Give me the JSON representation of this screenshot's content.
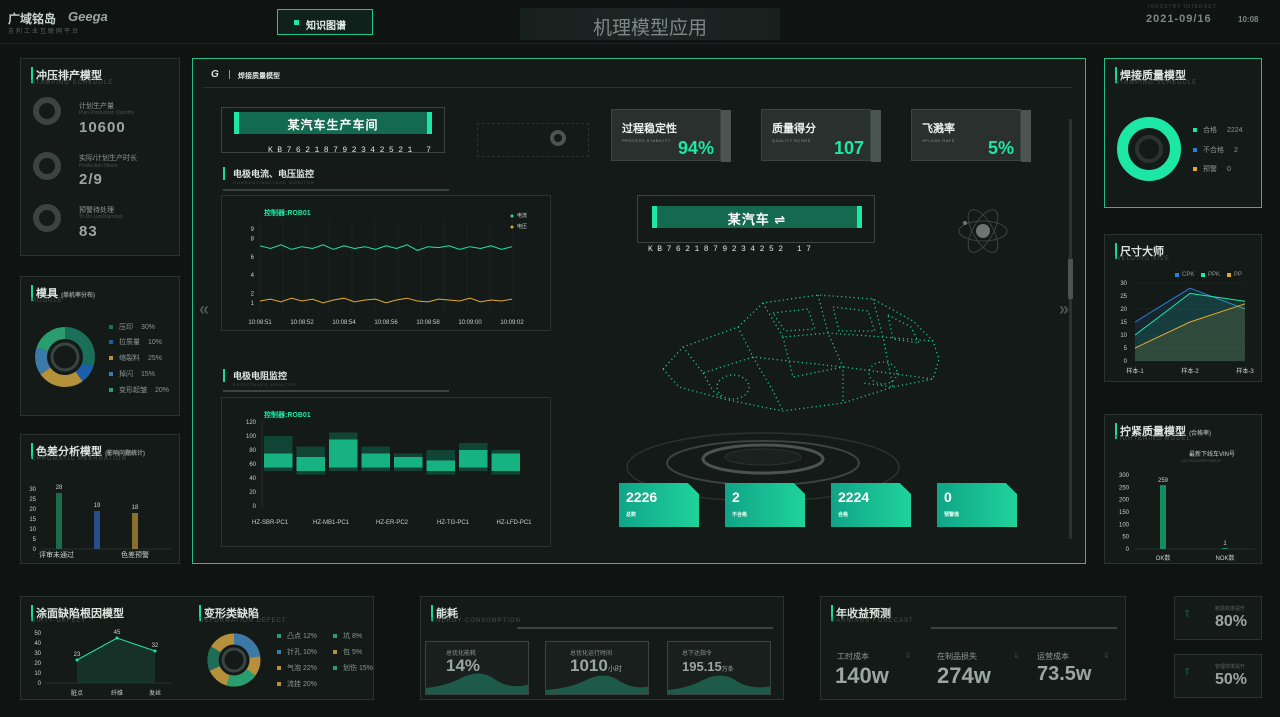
{
  "header": {
    "logo_cn": "广域铭岛",
    "logo_en": "Geega",
    "logo_sub": "吉利工业互联网平台",
    "nav_button": "知识图谱",
    "title": "机理模型应用",
    "corner_label": "INDUSTRY INTERNET",
    "date": "2021-09/16",
    "time": "10:08"
  },
  "stamping": {
    "title": "冲压排产模型",
    "sub": "STAMPING SCHEDULE",
    "items": [
      {
        "label": "计划生产量",
        "sub": "Plan Production Quantity",
        "value": "10600"
      },
      {
        "label": "实际/计划生产时长",
        "sub": "Production Hours",
        "value": "2/9"
      },
      {
        "label": "预警待处理",
        "sub": "To Do List(Warning)",
        "value": "83"
      }
    ]
  },
  "mold": {
    "title": "模具",
    "title_note": "(单机率分布)",
    "sub": "MODULE",
    "items": [
      {
        "label": "压印",
        "value": "30%",
        "color": "#1b6e58"
      },
      {
        "label": "拉质量",
        "value": "10%",
        "color": "#1d5ea8"
      },
      {
        "label": "缩裂料",
        "value": "25%",
        "color": "#b4913a"
      },
      {
        "label": "掉闪",
        "value": "15%",
        "color": "#3c78a8"
      },
      {
        "label": "变形起皱",
        "value": "20%",
        "color": "#2a9d6e"
      }
    ]
  },
  "color_analysis": {
    "title": "色差分析模型",
    "title_note": "(影响问题统计)",
    "sub": "CHROMATIC ABERRATION",
    "y_ticks": [
      "30",
      "25",
      "20",
      "15",
      "10",
      "5",
      "0"
    ],
    "bars": [
      {
        "value": 28
      },
      {
        "value": 19
      },
      {
        "value": 18
      }
    ],
    "x_labels": [
      "评审未通过",
      "色差预警"
    ]
  },
  "main": {
    "logo": "G",
    "breadcrumb": "焊接质量模型",
    "workshop": "某汽车生产车间",
    "workshop_code": "KB76218792342521 7",
    "car": "某汽车 ⇌",
    "car_code": "KB7621879234252 17",
    "kpis": [
      {
        "title": "过程稳定性",
        "sub": "PROCESS STABILITY",
        "value": "94%"
      },
      {
        "title": "质量得分",
        "sub": "QUALITY SCORE",
        "value": "107"
      },
      {
        "title": "飞溅率",
        "sub": "SPLASH RATE",
        "value": "5%"
      }
    ],
    "stats": [
      {
        "value": "2226",
        "label": "总数"
      },
      {
        "value": "2",
        "label": "不合格"
      },
      {
        "value": "2224",
        "label": "合格"
      },
      {
        "value": "0",
        "label": "预警值"
      }
    ]
  },
  "chart_data": [
    {
      "type": "line",
      "title": "电极电流、电压监控",
      "subtitle": "CURRENT/VOLTAGE MONITOR",
      "controller": "控制器:ROB01",
      "x": [
        "10:08:51",
        "10:08:52",
        "10:08:54",
        "10:08:56",
        "10:08:58",
        "10:09:00",
        "10:09:02"
      ],
      "y_ticks": [
        1,
        2,
        4,
        6,
        8,
        9
      ],
      "ylim": [
        0,
        10
      ],
      "series": [
        {
          "name": "电流",
          "color": "#1de7a5",
          "values": [
            7.2,
            6.9,
            7.3,
            6.8,
            7.1,
            6.9,
            7.3,
            6.8,
            7.2,
            6.9,
            7.1,
            6.8,
            7.2,
            6.9,
            7.3,
            6.7,
            7.1,
            7.0,
            7.2,
            6.8,
            7.1,
            6.9,
            7.2,
            6.8,
            7.1
          ]
        },
        {
          "name": "电压",
          "color": "#e0a931",
          "values": [
            1.2,
            1.4,
            1.1,
            1.5,
            1.2,
            1.4,
            1.0,
            1.3,
            1.5,
            1.1,
            1.3,
            1.4,
            1.0,
            1.3,
            1.5,
            1.2,
            1.1,
            1.4,
            1.3,
            1.2,
            1.5,
            1.1,
            1.3,
            1.2,
            1.4
          ]
        }
      ]
    },
    {
      "type": "bar",
      "title": "电极电阻监控",
      "subtitle": "RESISTANCE MONITOR",
      "controller": "控制器:ROB01",
      "categories": [
        "HZ-SBR-PC1",
        "HZ-MB1-PC1",
        "HZ-ER-PC2",
        "HZ-TG-PC1",
        "HZ-LFD-PC1"
      ],
      "y_ticks": [
        0,
        20,
        40,
        60,
        80,
        100,
        120
      ],
      "ylim": [
        0,
        120
      ],
      "ranges": [
        [
          [
            50,
            100
          ],
          [
            55,
            75
          ]
        ],
        [
          [
            45,
            85
          ],
          [
            50,
            70
          ]
        ],
        [
          [
            50,
            105
          ],
          [
            55,
            95
          ]
        ],
        [
          [
            50,
            85
          ],
          [
            55,
            75
          ]
        ],
        [
          [
            50,
            75
          ],
          [
            55,
            70
          ]
        ],
        [
          [
            45,
            80
          ],
          [
            50,
            65
          ]
        ],
        [
          [
            50,
            90
          ],
          [
            55,
            80
          ]
        ],
        [
          [
            45,
            80
          ],
          [
            50,
            75
          ]
        ]
      ]
    },
    {
      "type": "line",
      "title": "尺寸大师",
      "sub": "WELDING SIZE",
      "categories": [
        "样本-1",
        "样本-2",
        "样本-3"
      ],
      "y_ticks": [
        0,
        5,
        10,
        15,
        20,
        25,
        30
      ],
      "ylim": [
        0,
        30
      ],
      "series": [
        {
          "name": "CPK",
          "color": "#2a7fd6",
          "values": [
            15,
            28,
            20
          ]
        },
        {
          "name": "PPK",
          "color": "#1de7a5",
          "values": [
            10,
            26,
            23
          ]
        },
        {
          "name": "PP",
          "color": "#e0a931",
          "values": [
            5,
            15,
            22
          ]
        }
      ]
    },
    {
      "type": "bar",
      "title": "拧紧质量模型",
      "title_note": "(合格率)",
      "sub": "TIGHTENING MODEL",
      "note": "最新下线车VIN号",
      "vin": "LB1782318MP093949",
      "categories": [
        "OK数",
        "NOK数"
      ],
      "values": [
        259,
        1
      ],
      "y_ticks": [
        0,
        50,
        100,
        150,
        200,
        250,
        300
      ],
      "ylim": [
        0,
        300
      ]
    },
    {
      "type": "line",
      "title": "涂面缺陷根因模型",
      "sub": "DIRTY DEFECT",
      "categories": [
        "脏点",
        "纤维",
        "发丝"
      ],
      "values": [
        23,
        45,
        32
      ],
      "y_ticks": [
        0,
        10,
        20,
        30,
        40,
        50
      ],
      "ylim": [
        0,
        50
      ]
    }
  ],
  "weld_quality": {
    "title": "焊接质量模型",
    "sub": "STAMPING SCHEDULE",
    "items": [
      {
        "label": "合格",
        "value": "2224",
        "color": "#1de7a5"
      },
      {
        "label": "不合格",
        "value": "2",
        "color": "#2a7fd6"
      },
      {
        "label": "预警",
        "value": "0",
        "color": "#e0a931"
      }
    ]
  },
  "deformation": {
    "title": "变形类缺陷",
    "sub": "DEFORMATION DEFECT",
    "items": [
      {
        "label": "凸点",
        "value": "12%",
        "color": "#2a9d6e"
      },
      {
        "label": "坑",
        "value": "8%",
        "color": "#2a9d6e"
      },
      {
        "label": "针孔",
        "value": "10%",
        "color": "#3c78a8"
      },
      {
        "label": "包",
        "value": "5%",
        "color": "#b4913a"
      },
      {
        "label": "气泡",
        "value": "22%",
        "color": "#b4913a"
      },
      {
        "label": "划伤",
        "value": "15%",
        "color": "#2a9d6e"
      },
      {
        "label": "流挂",
        "value": "20%",
        "color": "#b4913a"
      }
    ]
  },
  "energy": {
    "title": "能耗",
    "sub": "ENERGY CONSUMPTION",
    "cards": [
      {
        "label": "总优化能耗",
        "value": "14%",
        "unit": ""
      },
      {
        "label": "总优化运行时间",
        "value": "1010",
        "unit": "小时"
      },
      {
        "label": "总下达指令",
        "value": "195.15",
        "unit": "万条"
      }
    ]
  },
  "earnings": {
    "title": "年收益预测",
    "sub": "EARNINGS FORECAST",
    "items": [
      {
        "label": "工时成本",
        "value": "140w"
      },
      {
        "label": "在制品损失",
        "value": "274w"
      },
      {
        "label": "运营成本",
        "value": "73.5w"
      }
    ]
  },
  "right_bottom": [
    {
      "label": "制造效率提升",
      "value": "80%"
    },
    {
      "label": "管理效率提升",
      "value": "50%"
    }
  ]
}
